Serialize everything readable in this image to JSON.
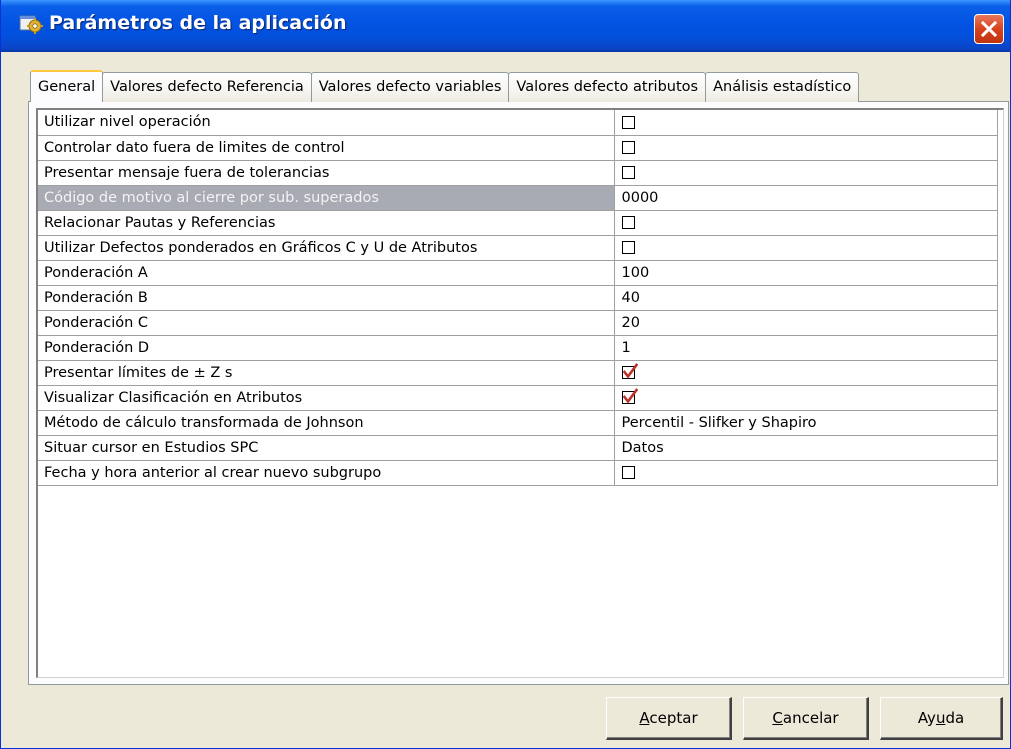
{
  "window": {
    "title": "Parámetros de la aplicación"
  },
  "tabs": [
    {
      "label": "General",
      "active": true
    },
    {
      "label": "Valores defecto Referencia",
      "active": false
    },
    {
      "label": "Valores defecto variables",
      "active": false
    },
    {
      "label": "Valores defecto atributos",
      "active": false
    },
    {
      "label": "Análisis estadístico",
      "active": false
    }
  ],
  "settings": [
    {
      "label": "Utilizar nivel operación",
      "type": "checkbox",
      "checked": false
    },
    {
      "label": "Controlar dato fuera de limites de control",
      "type": "checkbox",
      "checked": false
    },
    {
      "label": "Presentar mensaje fuera de tolerancias",
      "type": "checkbox",
      "checked": false
    },
    {
      "label": "Código de motivo al cierre por sub. superados",
      "type": "text",
      "value": "0000",
      "selected": true
    },
    {
      "label": "Relacionar Pautas y Referencias",
      "type": "checkbox",
      "checked": false
    },
    {
      "label": "Utilizar Defectos ponderados en Gráficos C y U de Atributos",
      "type": "checkbox",
      "checked": false
    },
    {
      "label": "Ponderación A",
      "type": "text",
      "value": "100"
    },
    {
      "label": "Ponderación B",
      "type": "text",
      "value": "40"
    },
    {
      "label": "Ponderación C",
      "type": "text",
      "value": "20"
    },
    {
      "label": "Ponderación D",
      "type": "text",
      "value": "1"
    },
    {
      "label": "Presentar límites de ± Z s",
      "type": "checkbox",
      "checked": true
    },
    {
      "label": "Visualizar Clasificación en Atributos",
      "type": "checkbox",
      "checked": true
    },
    {
      "label": "Método de cálculo transformada de Johnson",
      "type": "text",
      "value": "Percentil - Slifker y Shapiro"
    },
    {
      "label": "Situar cursor en Estudios SPC",
      "type": "text",
      "value": "Datos"
    },
    {
      "label": "Fecha y hora anterior al crear nuevo subgrupo",
      "type": "checkbox",
      "checked": false
    }
  ],
  "buttons": {
    "accept": {
      "label": "Aceptar",
      "underline": "A",
      "rest": "ceptar"
    },
    "cancel": {
      "label": "Cancelar",
      "underline": "C",
      "rest": "ancelar"
    },
    "help": {
      "label": "Ayuda",
      "pre": "Ay",
      "underline": "u",
      "rest": "da"
    }
  },
  "colors": {
    "title_bar": "#0354e3",
    "tab_highlight": "#ffc83c",
    "selected_row": "#a8aab4",
    "check_mark": "#c0302a"
  }
}
